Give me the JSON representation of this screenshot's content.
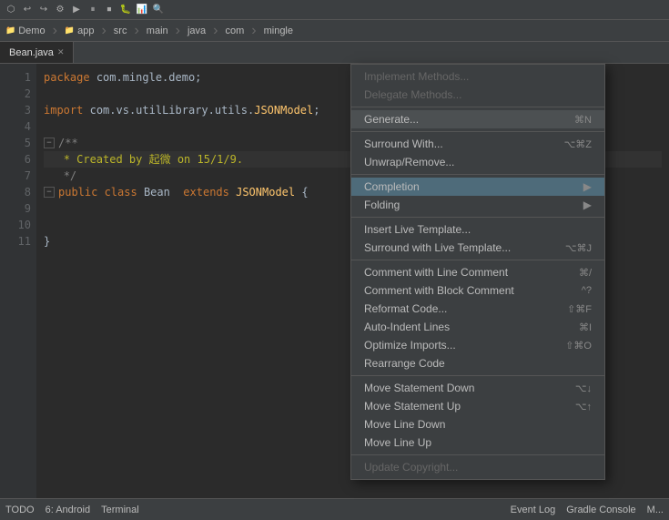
{
  "toolbar": {
    "icons": [
      "⬡",
      "↩",
      "↪",
      "▶",
      "⏸",
      "⏹",
      "🐛",
      "📊",
      "⚙",
      "🔍",
      "💡",
      "🛠"
    ]
  },
  "project_bar": {
    "items": [
      "Demo",
      "app",
      "src",
      "main",
      "java",
      "com",
      "mingle"
    ]
  },
  "tab": {
    "label": "Bean.java",
    "active": true
  },
  "code": {
    "lines": [
      {
        "num": "",
        "content": "package com.mingle.demo;"
      },
      {
        "num": "",
        "content": ""
      },
      {
        "num": "",
        "content": "import com.vs.utilLibrary.utils.JSONModel;"
      },
      {
        "num": "",
        "content": ""
      },
      {
        "num": "",
        "content": "/**"
      },
      {
        "num": "",
        "content": " * Created by 起微 on 15/1/9."
      },
      {
        "num": "",
        "content": " */"
      },
      {
        "num": "",
        "content": "public class Bean  extends JSONModel {"
      },
      {
        "num": "",
        "content": ""
      },
      {
        "num": "",
        "content": ""
      },
      {
        "num": "",
        "content": "}"
      }
    ]
  },
  "context_menu": {
    "items": [
      {
        "id": "implement-methods",
        "label": "Implement Methods...",
        "shortcut": "",
        "disabled": true,
        "type": "item"
      },
      {
        "id": "delegate-methods",
        "label": "Delegate Methods...",
        "shortcut": "",
        "disabled": true,
        "type": "item"
      },
      {
        "id": "sep1",
        "type": "separator"
      },
      {
        "id": "generate",
        "label": "Generate...",
        "shortcut": "⌘N",
        "disabled": false,
        "type": "item",
        "highlighted": true
      },
      {
        "id": "sep2",
        "type": "separator"
      },
      {
        "id": "surround-with",
        "label": "Surround With...",
        "shortcut": "⌥⌘Z",
        "disabled": false,
        "type": "item"
      },
      {
        "id": "unwrap-remove",
        "label": "Unwrap/Remove...",
        "shortcut": "",
        "disabled": false,
        "type": "item"
      },
      {
        "id": "sep3",
        "type": "separator"
      },
      {
        "id": "completion",
        "label": "Completion",
        "shortcut": "",
        "disabled": false,
        "type": "submenu",
        "highlighted": true
      },
      {
        "id": "folding",
        "label": "Folding",
        "shortcut": "",
        "disabled": false,
        "type": "submenu"
      },
      {
        "id": "sep4",
        "type": "separator"
      },
      {
        "id": "insert-live-template",
        "label": "Insert Live Template...",
        "shortcut": "",
        "disabled": false,
        "type": "item"
      },
      {
        "id": "surround-live-template",
        "label": "Surround with Live Template...",
        "shortcut": "⌥⌘J",
        "disabled": false,
        "type": "item"
      },
      {
        "id": "sep5",
        "type": "separator"
      },
      {
        "id": "comment-line",
        "label": "Comment with Line Comment",
        "shortcut": "⌘/",
        "disabled": false,
        "type": "item"
      },
      {
        "id": "comment-block",
        "label": "Comment with Block Comment",
        "shortcut": "^?",
        "disabled": false,
        "type": "item"
      },
      {
        "id": "reformat-code",
        "label": "Reformat Code...",
        "shortcut": "⇧⌘F",
        "disabled": false,
        "type": "item"
      },
      {
        "id": "auto-indent",
        "label": "Auto-Indent Lines",
        "shortcut": "⌘I",
        "disabled": false,
        "type": "item"
      },
      {
        "id": "optimize-imports",
        "label": "Optimize Imports...",
        "shortcut": "⇧⌘O",
        "disabled": false,
        "type": "item"
      },
      {
        "id": "rearrange-code",
        "label": "Rearrange Code",
        "shortcut": "",
        "disabled": false,
        "type": "item"
      },
      {
        "id": "sep6",
        "type": "separator"
      },
      {
        "id": "move-statement-down",
        "label": "Move Statement Down",
        "shortcut": "⌥↓",
        "disabled": false,
        "type": "item"
      },
      {
        "id": "move-statement-up",
        "label": "Move Statement Up",
        "shortcut": "⌥↑",
        "disabled": false,
        "type": "item"
      },
      {
        "id": "move-line-down",
        "label": "Move Line Down",
        "shortcut": "",
        "disabled": false,
        "type": "item"
      },
      {
        "id": "move-line-up",
        "label": "Move Line Up",
        "shortcut": "",
        "disabled": false,
        "type": "item"
      },
      {
        "id": "sep7",
        "type": "separator"
      },
      {
        "id": "update-copyright",
        "label": "Update Copyright...",
        "shortcut": "",
        "disabled": true,
        "type": "item"
      }
    ]
  },
  "status_bar": {
    "items": [
      "TODO",
      "6: Android",
      "Terminal",
      "Event Log",
      "Gradle Console",
      "M..."
    ]
  }
}
